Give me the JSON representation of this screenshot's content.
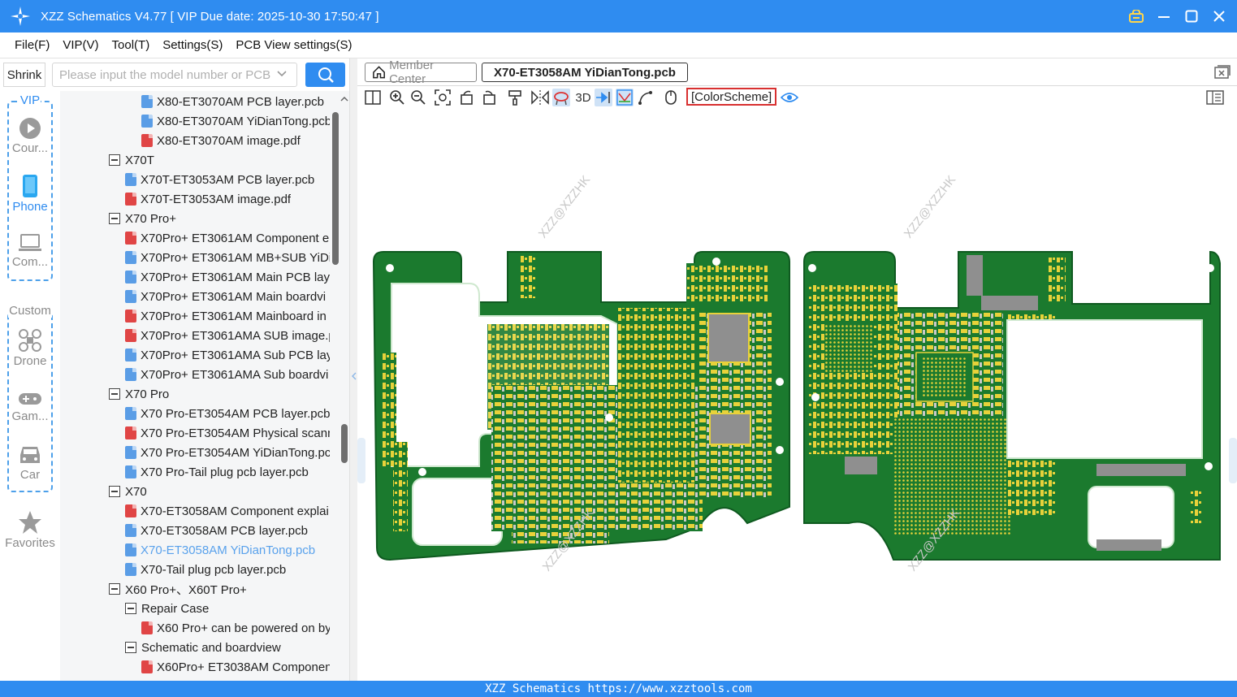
{
  "titlebar": {
    "title": "XZZ Schematics V4.77 [ VIP Due date: 2025-10-30 17:50:47 ]"
  },
  "menu": [
    "File(F)",
    "VIP(V)",
    "Tool(T)",
    "Settings(S)",
    "PCB View settings(S)"
  ],
  "search": {
    "shrink_label": "Shrink",
    "placeholder": "Please input the model number or PCB",
    "value": ""
  },
  "rail": {
    "vip_label": "VIP",
    "custom_label": "Custom",
    "items": [
      {
        "label": "Cour...",
        "icon": "play-icon"
      },
      {
        "label": "Phone",
        "icon": "phone-icon",
        "active": true
      },
      {
        "label": "Com...",
        "icon": "laptop-icon"
      },
      {
        "label": "Drone",
        "icon": "drone-icon"
      },
      {
        "label": "Gam...",
        "icon": "gamepad-icon"
      },
      {
        "label": "Car",
        "icon": "car-icon"
      },
      {
        "label": "Favorites",
        "icon": "star-icon"
      }
    ]
  },
  "tree": [
    {
      "level": 3,
      "type": "pcb",
      "text": "X80-ET3070AM PCB layer.pcb"
    },
    {
      "level": 3,
      "type": "pcb",
      "text": "X80-ET3070AM YiDianTong.pcb"
    },
    {
      "level": 3,
      "type": "pdf",
      "text": "X80-ET3070AM image.pdf"
    },
    {
      "level": 1,
      "type": "folder",
      "text": "X70T"
    },
    {
      "level": 2,
      "type": "pcb",
      "text": "X70T-ET3053AM PCB layer.pcb"
    },
    {
      "level": 2,
      "type": "pdf",
      "text": "X70T-ET3053AM image.pdf"
    },
    {
      "level": 1,
      "type": "folder",
      "text": "X70 Pro+"
    },
    {
      "level": 2,
      "type": "pdf",
      "text": "X70Pro+ ET3061AM Component e"
    },
    {
      "level": 2,
      "type": "pcb",
      "text": "X70Pro+ ET3061AM MB+SUB YiDi"
    },
    {
      "level": 2,
      "type": "pcb",
      "text": "X70Pro+ ET3061AM Main PCB laye"
    },
    {
      "level": 2,
      "type": "pcb",
      "text": "X70Pro+ ET3061AM Main boardvi"
    },
    {
      "level": 2,
      "type": "pdf",
      "text": "X70Pro+ ET3061AM Mainboard in"
    },
    {
      "level": 2,
      "type": "pdf",
      "text": "X70Pro+ ET3061AMA SUB image.p"
    },
    {
      "level": 2,
      "type": "pcb",
      "text": "X70Pro+ ET3061AMA Sub PCB laye"
    },
    {
      "level": 2,
      "type": "pcb",
      "text": "X70Pro+ ET3061AMA Sub boardvi"
    },
    {
      "level": 1,
      "type": "folder",
      "text": "X70 Pro"
    },
    {
      "level": 2,
      "type": "pcb",
      "text": "X70 Pro-ET3054AM PCB layer.pcb"
    },
    {
      "level": 2,
      "type": "pdf",
      "text": "X70 Pro-ET3054AM Physical scann"
    },
    {
      "level": 2,
      "type": "pcb",
      "text": "X70 Pro-ET3054AM YiDianTong.pc"
    },
    {
      "level": 2,
      "type": "pcb",
      "text": "X70 Pro-Tail plug pcb layer.pcb"
    },
    {
      "level": 1,
      "type": "folder",
      "text": "X70"
    },
    {
      "level": 2,
      "type": "pdf",
      "text": "X70-ET3058AM Component explai"
    },
    {
      "level": 2,
      "type": "pcb",
      "text": "X70-ET3058AM PCB layer.pcb"
    },
    {
      "level": 2,
      "type": "pcb",
      "text": "X70-ET3058AM YiDianTong.pcb",
      "selected": true
    },
    {
      "level": 2,
      "type": "pcb",
      "text": "X70-Tail plug pcb layer.pcb"
    },
    {
      "level": 1,
      "type": "folder",
      "text": "X60 Pro+、X60T Pro+"
    },
    {
      "level": 2,
      "type": "folder",
      "text": "Repair Case"
    },
    {
      "level": 3,
      "type": "pdf",
      "text": "X60 Pro+ can be powered on by"
    },
    {
      "level": 2,
      "type": "folder",
      "text": "Schematic and boardview"
    },
    {
      "level": 3,
      "type": "pdf",
      "text": "X60Pro+ ET3038AM Componen"
    }
  ],
  "tabs": {
    "member": "Member Center",
    "active": "X70-ET3058AM YiDianTong.pcb"
  },
  "toolbar": {
    "three_d": "3D",
    "color_scheme": "[ColorScheme]"
  },
  "canvas": {
    "watermark": "XZZ@XZZHK"
  },
  "status": {
    "text": "XZZ Schematics https://www.xzztools.com"
  },
  "colors": {
    "accent": "#2f8cf0",
    "pcb_green": "#1b7a2e",
    "pad_yellow": "#e8d23a",
    "chip_gray": "#8f8f8f"
  }
}
